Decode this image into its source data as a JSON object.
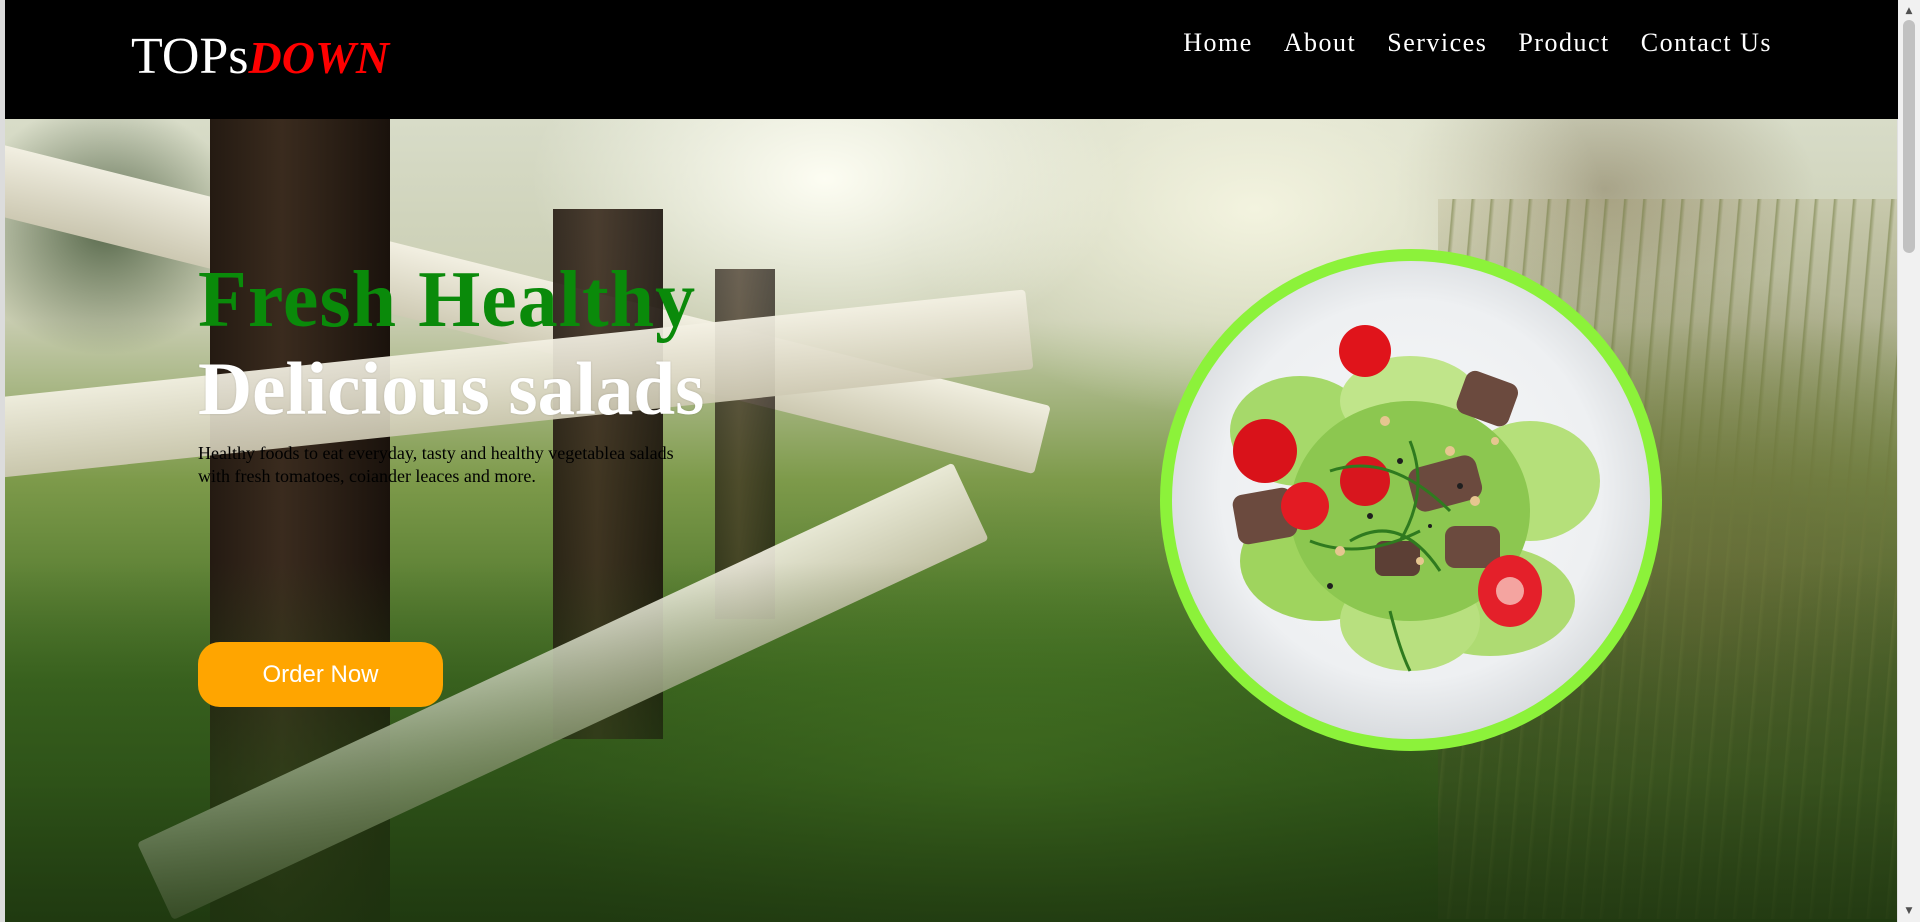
{
  "header": {
    "logo_main": "TOPs",
    "logo_accent": "DOWN",
    "nav": [
      "Home",
      "About",
      "Services",
      "Product",
      "Contact Us"
    ]
  },
  "hero": {
    "title": "Fresh Healthy",
    "subtitle": "Delicious salads",
    "description": "Healthy foods to eat everyday, tasty and healthy vegetablea salads with fresh tomatoes, coiander leaces and more.",
    "cta": "Order Now"
  },
  "colors": {
    "navbar_bg": "#000000",
    "logo_accent": "#ff0000",
    "title": "#0a8a0a",
    "cta_bg": "#ffa500",
    "plate_ring": "#8cf23a"
  },
  "icons": {
    "scroll_up": "up-triangle",
    "scroll_down": "down-triangle"
  },
  "scroll": {
    "up_glyph": "▲",
    "down_glyph": "▼"
  }
}
